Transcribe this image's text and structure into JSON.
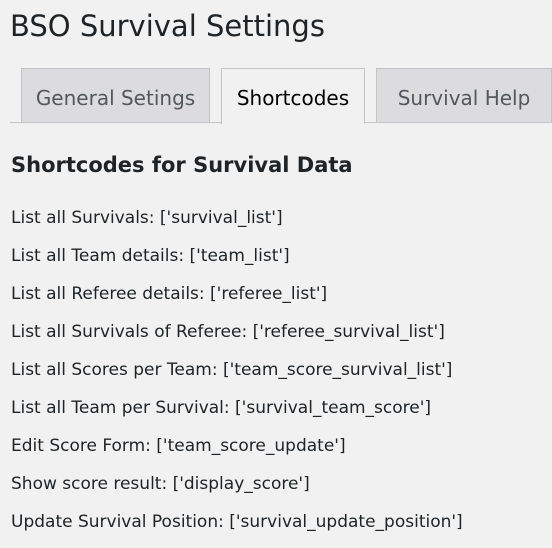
{
  "page": {
    "title": "BSO Survival Settings"
  },
  "tabs": [
    {
      "label": "General Setings",
      "active": false
    },
    {
      "label": "Shortcodes",
      "active": true
    },
    {
      "label": "Survival Help",
      "active": false
    }
  ],
  "section": {
    "heading": "Shortcodes for Survival Data"
  },
  "shortcodes": [
    "List all Survivals: ['survival_list']",
    "List all Team details: ['team_list']",
    "List all Referee details: ['referee_list']",
    "List all Survivals of Referee: ['referee_survival_list']",
    "List all Scores per Team: ['team_score_survival_list']",
    "List all Team per Survival: ['survival_team_score']",
    "Edit Score Form: ['team_score_update']",
    "Show score result: ['display_score']",
    "Update Survival Position: ['survival_update_position']"
  ],
  "colors": {
    "background": "#f1f1f1",
    "text": "#1d2327",
    "inactive_tab_bg": "#dcdcde",
    "inactive_tab_text": "#50575e",
    "border": "#c3c4c7"
  }
}
